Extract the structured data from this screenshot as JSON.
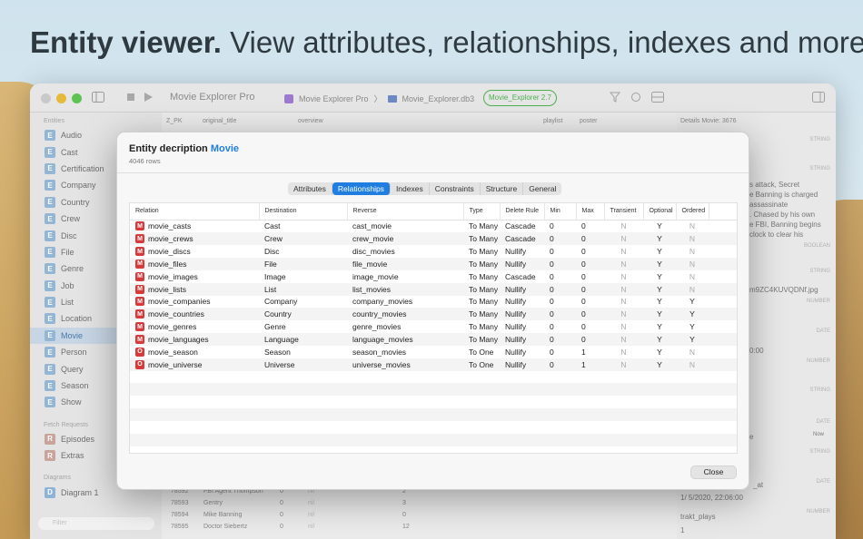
{
  "headline": {
    "bold": "Entity viewer.",
    "rest": " View attributes, relationships, indexes and more."
  },
  "window": {
    "app_title": "Movie Explorer Pro",
    "path": [
      "Movie Explorer Pro",
      "Movie_Explorer.db3"
    ],
    "version_badge": "Movie_Explorer 2.7"
  },
  "sidebar": {
    "entities_label": "Entities",
    "entities": [
      "Audio",
      "Cast",
      "Certification",
      "Company",
      "Country",
      "Crew",
      "Disc",
      "File",
      "Genre",
      "Job",
      "List",
      "Location",
      "Movie",
      "Person",
      "Query",
      "Season",
      "Show"
    ],
    "selected": "Movie",
    "fetch_label": "Fetch Requests",
    "fetch": [
      "Episodes",
      "Extras"
    ],
    "diagrams_label": "Diagrams",
    "diagrams": [
      "Diagram 1"
    ],
    "filter_placeholder": "Filter"
  },
  "grid": {
    "columns": [
      "Z_PK",
      "original_title",
      "overview",
      "playlist",
      "poster"
    ],
    "rows": [
      [
        "78592",
        "FBI Agent Thompson",
        "0",
        "nil",
        "2"
      ],
      [
        "78593",
        "Gentry",
        "0",
        "nil",
        "3"
      ],
      [
        "78594",
        "Mike Banning",
        "0",
        "nil",
        "0"
      ],
      [
        "78595",
        "Doctor Siebertz",
        "0",
        "nil",
        "12"
      ]
    ]
  },
  "details": {
    "header": "Details Movie: 3676",
    "labels": [
      "STRING",
      "STRING",
      "BOOLEAN",
      "STRING",
      "NUMBER",
      "DATE",
      "NUMBER",
      "STRING",
      "DATE",
      "STRING",
      "DATE",
      "NUMBER"
    ],
    "overview_snippet": [
      "s attack, Secret",
      "e Banning is charged",
      "assassinate",
      ". Chased by his own",
      "e FBI, Banning begins",
      "clock to clear his"
    ],
    "poster_value": "m9ZC4KUVQDNf.jpg",
    "date_value": "0:00",
    "now_button": "Now",
    "e_value": "e",
    "updated_label": "_at",
    "updated_value": "1/  5/2020, 22:06:00",
    "trakt_label": "trakt_plays",
    "trakt_value": "1"
  },
  "modal": {
    "title_prefix": "Entity decription",
    "entity": "Movie",
    "row_count": "4046 rows",
    "tabs": [
      "Attributes",
      "Relationships",
      "Indexes",
      "Constraints",
      "Structure",
      "General"
    ],
    "active_tab": "Relationships",
    "columns": [
      "Relation",
      "Destination",
      "Reverse",
      "Type",
      "Delete Rule",
      "Min",
      "Max",
      "Transient",
      "Optional",
      "Ordered"
    ],
    "rows": [
      {
        "tag": "M",
        "relation": "movie_casts",
        "destination": "Cast",
        "reverse": "cast_movie",
        "type": "To Many",
        "delete": "Cascade",
        "min": "0",
        "max": "0",
        "transient": "N",
        "optional": "Y",
        "ordered": "N"
      },
      {
        "tag": "M",
        "relation": "movie_crews",
        "destination": "Crew",
        "reverse": "crew_movie",
        "type": "To Many",
        "delete": "Cascade",
        "min": "0",
        "max": "0",
        "transient": "N",
        "optional": "Y",
        "ordered": "N"
      },
      {
        "tag": "M",
        "relation": "movie_discs",
        "destination": "Disc",
        "reverse": "disc_movies",
        "type": "To Many",
        "delete": "Nullify",
        "min": "0",
        "max": "0",
        "transient": "N",
        "optional": "Y",
        "ordered": "N"
      },
      {
        "tag": "M",
        "relation": "movie_files",
        "destination": "File",
        "reverse": "file_movie",
        "type": "To Many",
        "delete": "Nullify",
        "min": "0",
        "max": "0",
        "transient": "N",
        "optional": "Y",
        "ordered": "N"
      },
      {
        "tag": "M",
        "relation": "movie_images",
        "destination": "Image",
        "reverse": "image_movie",
        "type": "To Many",
        "delete": "Cascade",
        "min": "0",
        "max": "0",
        "transient": "N",
        "optional": "Y",
        "ordered": "N"
      },
      {
        "tag": "M",
        "relation": "movie_lists",
        "destination": "List",
        "reverse": "list_movies",
        "type": "To Many",
        "delete": "Nullify",
        "min": "0",
        "max": "0",
        "transient": "N",
        "optional": "Y",
        "ordered": "N"
      },
      {
        "tag": "M",
        "relation": "movie_companies",
        "destination": "Company",
        "reverse": "company_movies",
        "type": "To Many",
        "delete": "Nullify",
        "min": "0",
        "max": "0",
        "transient": "N",
        "optional": "Y",
        "ordered": "Y"
      },
      {
        "tag": "M",
        "relation": "movie_countries",
        "destination": "Country",
        "reverse": "country_movies",
        "type": "To Many",
        "delete": "Nullify",
        "min": "0",
        "max": "0",
        "transient": "N",
        "optional": "Y",
        "ordered": "Y"
      },
      {
        "tag": "M",
        "relation": "movie_genres",
        "destination": "Genre",
        "reverse": "genre_movies",
        "type": "To Many",
        "delete": "Nullify",
        "min": "0",
        "max": "0",
        "transient": "N",
        "optional": "Y",
        "ordered": "Y"
      },
      {
        "tag": "M",
        "relation": "movie_languages",
        "destination": "Language",
        "reverse": "language_movies",
        "type": "To Many",
        "delete": "Nullify",
        "min": "0",
        "max": "0",
        "transient": "N",
        "optional": "Y",
        "ordered": "Y"
      },
      {
        "tag": "O",
        "relation": "movie_season",
        "destination": "Season",
        "reverse": "season_movies",
        "type": "To One",
        "delete": "Nullify",
        "min": "0",
        "max": "1",
        "transient": "N",
        "optional": "Y",
        "ordered": "N"
      },
      {
        "tag": "O",
        "relation": "movie_universe",
        "destination": "Universe",
        "reverse": "universe_movies",
        "type": "To One",
        "delete": "Nullify",
        "min": "0",
        "max": "1",
        "transient": "N",
        "optional": "Y",
        "ordered": "N"
      }
    ],
    "empty_rows": 7,
    "close_label": "Close"
  },
  "colors": {
    "accent": "#1f7ee0",
    "tag_red": "#d73a3a",
    "version_green": "#4caf50"
  }
}
